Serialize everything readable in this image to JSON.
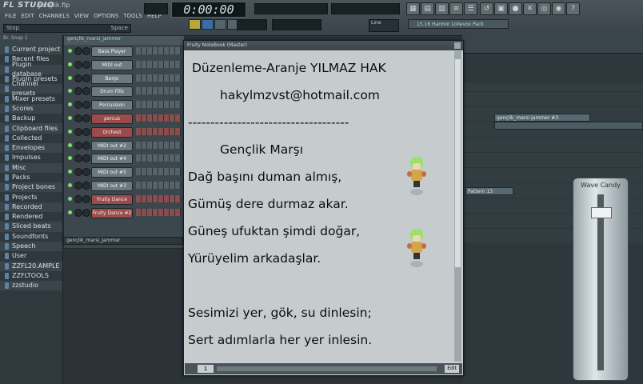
{
  "app": {
    "logo": "FL STUDIO",
    "filename": "gençlik.flp",
    "menu": [
      "FILE",
      "EDIT",
      "CHANNELS",
      "VIEW",
      "OPTIONS",
      "TOOLS",
      "HELP"
    ],
    "hint_left": "Stop",
    "hint_right": "Space",
    "time": "0:00:00",
    "tempo_label": "Line",
    "pattern_selector": "15.16 Harmor Lollevox Pack"
  },
  "browser": {
    "header": "Br. Snap 1",
    "items": [
      "Current project",
      "Recent files",
      "Plugin database",
      "Plugin presets",
      "Channel presets",
      "Mixer presets",
      "Scores",
      "Backup",
      "Clipboard files",
      "Collected",
      "Envelopes",
      "Impulses",
      "Misc",
      "Packs",
      "Project bones",
      "Projects",
      "Recorded",
      "Rendered",
      "Sliced beats",
      "Soundfonts",
      "Speech",
      "User",
      "ZZFL20.AMPLE",
      "ZZFLTOOLS",
      "zzstudio"
    ]
  },
  "rack": {
    "header": "gençlik_marsi_jammer",
    "channels": [
      "Bass Player",
      "MIDI out",
      "Banjo",
      "Drum Fills",
      "Percussion",
      "percus",
      "Orchest",
      "MIDI out #2",
      "MIDI out #4",
      "MIDI out #5",
      "MIDI out #3",
      "Fruity Dance",
      "Fruity Dance #2"
    ],
    "footer": "gençlik_marsi_jammer"
  },
  "playlist": {
    "clip1": "gençlik_marsi jammer #3",
    "clip2": "gençlik_marsi_jammer",
    "clip3": "Pattern 13",
    "plugin_name": "Wave Candy"
  },
  "notebook": {
    "title": "Fruity NoteBook (Master)",
    "lines": [
      "Düzenleme-Aranje YILMAZ HAK",
      "hakylmzvst@hotmail.com",
      "------------------------------------",
      "Gençlik Marşı",
      "Dağ başını duman almış,",
      "Gümüş dere durmaz akar.",
      "Güneş ufuktan şimdi doğar,",
      "Yürüyelim arkadaşlar.",
      "Sesimizi yer, gök, su dinlesin;",
      "Sert adımlarla her yer inlesin."
    ],
    "page": "1",
    "edit": "Edit"
  }
}
